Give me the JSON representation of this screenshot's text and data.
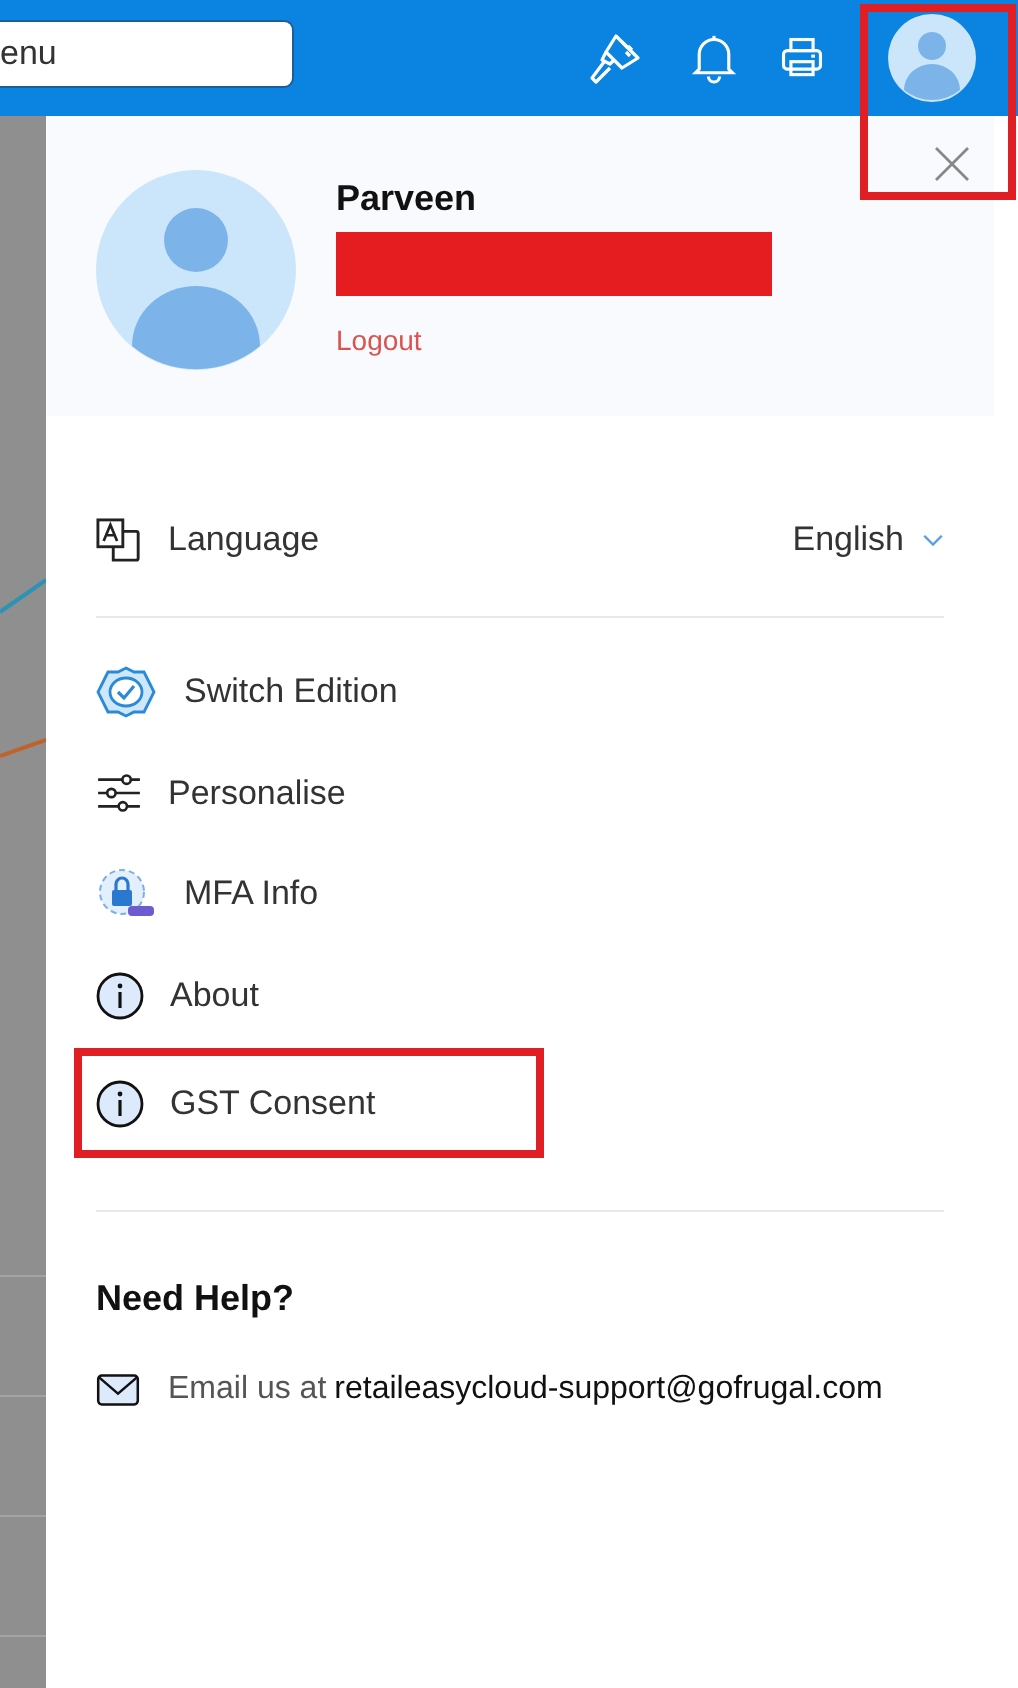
{
  "topbar": {
    "search": {
      "value": "enu"
    },
    "avatar": {
      "highlighted": true
    }
  },
  "profile": {
    "name": "Parveen",
    "redacted": true,
    "logout": "Logout"
  },
  "language": {
    "label": "Language",
    "value": "English"
  },
  "menu": [
    {
      "kind": "edition",
      "label": "Switch Edition",
      "highlighted": false
    },
    {
      "kind": "sliders",
      "label": "Personalise",
      "highlighted": false
    },
    {
      "kind": "mfa",
      "label": "MFA Info",
      "highlighted": false
    },
    {
      "kind": "info",
      "label": "About",
      "highlighted": false
    },
    {
      "kind": "info",
      "label": "GST Consent",
      "highlighted": true
    }
  ],
  "help": {
    "title": "Need Help?",
    "prefix": "Email us at",
    "email": "retaileasycloud-support@gofrugal.com"
  }
}
